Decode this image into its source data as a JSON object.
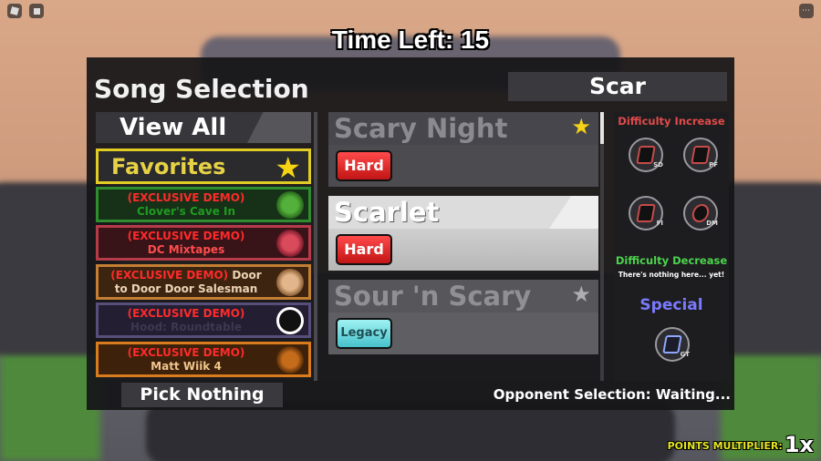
{
  "hud": {
    "time_left": "Time Left: 15",
    "points_label": "POINTS MULTIPLIER:",
    "points_value": "1x"
  },
  "panel": {
    "title": "Song Selection",
    "search_value": "Scar",
    "view_all_label": "View All",
    "favorites_label": "Favorites",
    "pick_nothing_label": "Pick Nothing",
    "opponent_status": "Opponent Selection: Waiting..."
  },
  "song_list": [
    {
      "line1": "(EXCLUSIVE DEMO)",
      "line2": "Clover's Cave In"
    },
    {
      "line1": "(EXCLUSIVE DEMO)",
      "line2": "DC Mixtapes"
    },
    {
      "line1_prefix": "(EXCLUSIVE DEMO)",
      "line1_rest": " Door",
      "line2": "to Door Door Salesman"
    },
    {
      "line1": "(EXCLUSIVE DEMO)",
      "line2": "Hood: Roundtable"
    },
    {
      "line1": "(EXCLUSIVE DEMO)",
      "line2": "Matt Wiik 4"
    }
  ],
  "results": [
    {
      "title": "Scary Night",
      "difficulty": "Hard",
      "favorited": true
    },
    {
      "title": "Scarlet",
      "difficulty": "Hard",
      "favorited": false
    },
    {
      "title": "Sour 'n Scary",
      "difficulty": "Legacy",
      "favorited": false
    }
  ],
  "modifiers": {
    "increase_title": "Difficulty Increase",
    "decrease_title": "Difficulty Decrease",
    "decrease_note": "There's nothing here... yet!",
    "special_title": "Special",
    "increase_items": [
      {
        "tag": "SD"
      },
      {
        "tag": "PF"
      },
      {
        "tag": "FI"
      },
      {
        "tag": "DM"
      }
    ],
    "special_items": [
      {
        "tag": "GT"
      }
    ]
  },
  "icons": {
    "favorite_star": "★",
    "corner_menu": "⋯"
  },
  "colors": {
    "exclusive_demo_red": "#ff2a2a",
    "favorites_gold": "#e1cc24",
    "hard_red": "#d42020",
    "legacy_cyan": "#6fd9e0"
  }
}
